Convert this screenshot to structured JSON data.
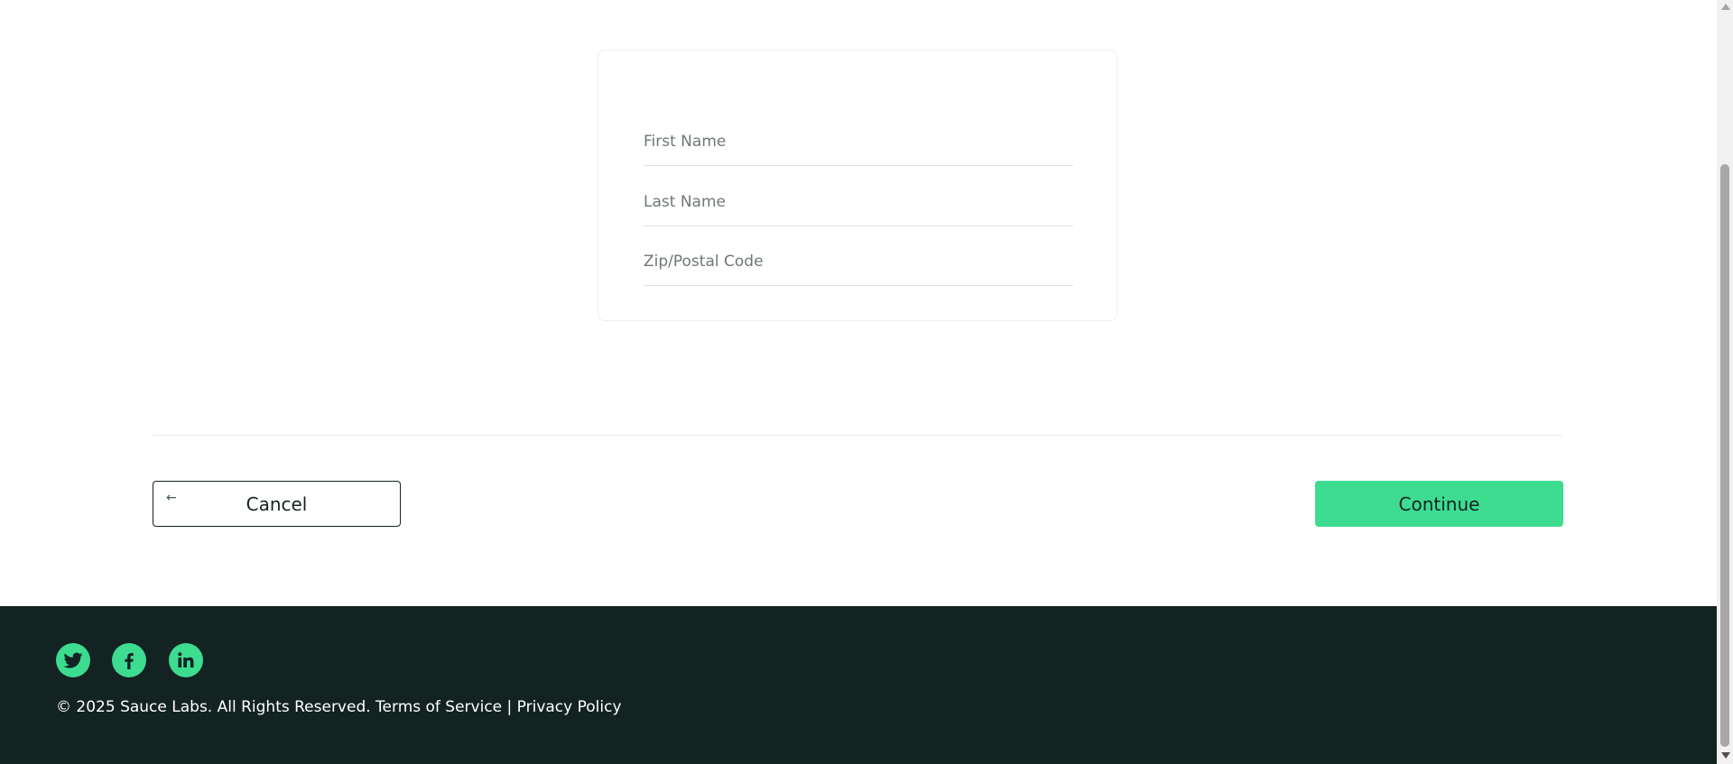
{
  "form": {
    "first_name_placeholder": "First Name",
    "last_name_placeholder": "Last Name",
    "postal_code_placeholder": "Zip/Postal Code"
  },
  "actions": {
    "cancel_arrow": "←",
    "cancel_label": "Cancel",
    "continue_label": "Continue"
  },
  "footer": {
    "social": [
      {
        "name": "Twitter",
        "icon": "twitter-icon"
      },
      {
        "name": "Facebook",
        "icon": "facebook-icon"
      },
      {
        "name": "LinkedIn",
        "icon": "linkedin-icon"
      }
    ],
    "copyright": "© 2025 Sauce Labs. All Rights Reserved. Terms of Service | Privacy Policy"
  },
  "colors": {
    "accent": "#3ddc91",
    "footer_background": "#132322",
    "text": "#132322"
  }
}
